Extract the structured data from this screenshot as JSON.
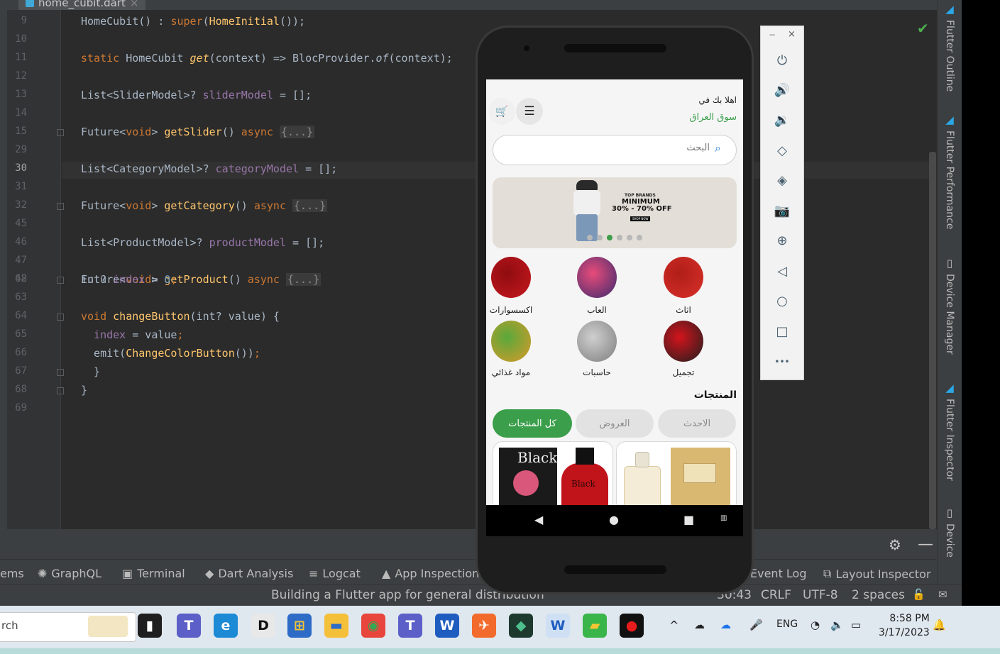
{
  "ide": {
    "tab_title": "home_cubit.dart",
    "tab_close": "×",
    "check_icon": "✔",
    "lines": [
      {
        "n": "9",
        "code": [
          [
            "",
            "HomeCubit() : "
          ],
          [
            "kw",
            "super"
          ],
          [
            "",
            "("
          ],
          [
            "fn",
            "HomeInitial"
          ],
          [
            "",
            "());"
          ]
        ]
      },
      {
        "n": "10",
        "code": []
      },
      {
        "n": "11",
        "code": [
          [
            "kw",
            "static "
          ],
          [
            "",
            "HomeCubit "
          ],
          [
            "fn italic",
            "get"
          ],
          [
            "",
            "(context) => BlocProvider."
          ],
          [
            "italic",
            "of"
          ],
          [
            "",
            "(context);"
          ]
        ]
      },
      {
        "n": "12",
        "code": []
      },
      {
        "n": "13",
        "code": [
          [
            "",
            "List<SliderModel>? "
          ],
          [
            "fld",
            "sliderModel"
          ],
          [
            "",
            " = [];"
          ]
        ]
      },
      {
        "n": "14",
        "code": []
      },
      {
        "n": "15",
        "code": [
          [
            "",
            "Future<"
          ],
          [
            "kw",
            "void"
          ],
          [
            "",
            "> "
          ],
          [
            "fn",
            "getSlider"
          ],
          [
            "",
            "() "
          ],
          [
            "kw",
            "async "
          ],
          [
            "fold-box",
            "{...}"
          ]
        ]
      },
      {
        "n": "29",
        "code": []
      },
      {
        "n": "30",
        "code": [
          [
            "",
            "List<CategoryModel>? "
          ],
          [
            "fld",
            "categoryModel"
          ],
          [
            "",
            " = [];"
          ]
        ]
      },
      {
        "n": "31",
        "code": []
      },
      {
        "n": "32",
        "code": [
          [
            "",
            "Future<"
          ],
          [
            "kw",
            "void"
          ],
          [
            "",
            "> "
          ],
          [
            "fn",
            "getCategory"
          ],
          [
            "",
            "() "
          ],
          [
            "kw",
            "async "
          ],
          [
            "fold-box",
            "{...}"
          ]
        ]
      },
      {
        "n": "45",
        "code": []
      },
      {
        "n": "46",
        "code": [
          [
            "",
            "List<ProductModel>? "
          ],
          [
            "fld",
            "productModel"
          ],
          [
            "",
            " = [];"
          ]
        ]
      },
      {
        "n": "47",
        "code": []
      },
      {
        "n": "48",
        "code": [
          [
            "",
            "Future<"
          ],
          [
            "kw",
            "void"
          ],
          [
            "",
            "> "
          ],
          [
            "fn",
            "getProduct"
          ],
          [
            "",
            "() "
          ],
          [
            "kw",
            "async "
          ],
          [
            "fold-box",
            "{...}"
          ]
        ]
      },
      {
        "n": "62",
        "code": [
          [
            "",
            "int? "
          ],
          [
            "fld",
            "index"
          ],
          [
            "",
            " = "
          ],
          [
            "num",
            "0"
          ],
          [
            "kw",
            ";"
          ]
        ]
      },
      {
        "n": "63",
        "code": []
      },
      {
        "n": "64",
        "code": [
          [
            "kw",
            "void "
          ],
          [
            "fn",
            "changeButton"
          ],
          [
            "",
            "(int? value) {"
          ]
        ]
      },
      {
        "n": "65",
        "code": [
          [
            "",
            "  "
          ],
          [
            "fld",
            "index"
          ],
          [
            "",
            " = value"
          ],
          [
            "kw",
            ";"
          ]
        ]
      },
      {
        "n": "66",
        "code": [
          [
            "",
            "  emit("
          ],
          [
            "fn",
            "ChangeColorButton"
          ],
          [
            "",
            "())"
          ],
          [
            "kw",
            ";"
          ]
        ]
      },
      {
        "n": "67",
        "code": [
          [
            "",
            "  }"
          ]
        ]
      },
      {
        "n": "68",
        "code": [
          [
            "",
            "}"
          ]
        ]
      },
      {
        "n": "69",
        "code": []
      }
    ],
    "current_line": "30",
    "right_tabs": [
      "Flutter Outline",
      "Flutter Performance",
      "Device Manager",
      "Flutter Inspector",
      "Device"
    ],
    "tool_windows": [
      {
        "label": "ems",
        "icon": ""
      },
      {
        "label": "GraphQL",
        "icon": "✺"
      },
      {
        "label": "Terminal",
        "icon": "▣"
      },
      {
        "label": "Dart Analysis",
        "icon": "◆"
      },
      {
        "label": "Logcat",
        "icon": "≡"
      },
      {
        "label": "App Inspection",
        "icon": "▲"
      },
      {
        "label": "Event Log",
        "icon": ""
      },
      {
        "label": "Layout Inspector",
        "icon": "⧉"
      }
    ],
    "status_message": "Building a Flutter app for general distribution",
    "status_position": "30:43",
    "status_line_ending": "CRLF",
    "status_encoding": "UTF-8",
    "status_indent": "2 spaces",
    "status_lock_icon": "🔓",
    "status_notify_icon": "✉"
  },
  "emulator": {
    "window_minimize": "−",
    "window_close": "×",
    "controls": [
      "power-icon",
      "volume-up-icon",
      "volume-down-icon",
      "rotate-left-icon",
      "rotate-right-icon",
      "camera-icon",
      "zoom-icon",
      "back-icon",
      "home-icon",
      "overview-icon",
      "more-icon"
    ],
    "control_glyphs": [
      "⏻",
      "🔊",
      "🔉",
      "◇",
      "◈",
      "📷",
      "⊕",
      "◁",
      "○",
      "□",
      "•••"
    ]
  },
  "app": {
    "greeting_line1": "اهلا بك في",
    "greeting_line2": "سوق العراق",
    "menu_icon": "☰",
    "cart_icon": "🛒",
    "search_placeholder": "البحث",
    "search_icon": "⌕",
    "banner": {
      "top": "TOP BRANDS",
      "headline": "MINIMUM",
      "offer": "30% - 70% OFF",
      "cta": "SHOP NOW"
    },
    "carousel_dots": 6,
    "carousel_active": 2,
    "categories": [
      {
        "label": "اثاث",
        "color": "#d9302a",
        "accent": "#b01e18"
      },
      {
        "label": "العاب",
        "color": "#3b2a6e",
        "accent": "#e84c7a"
      },
      {
        "label": "اكسسوارات",
        "color": "#c7191f",
        "accent": "#8e0c10"
      },
      {
        "label": "تجميل",
        "color": "#1e1e1e",
        "accent": "#d3141c"
      },
      {
        "label": "حاسبات",
        "color": "#7e7e7e",
        "accent": "#cfcfcf"
      },
      {
        "label": "مواد غذائي",
        "color": "#d99a2a",
        "accent": "#59a83a"
      }
    ],
    "products_title": "المنتجات",
    "filters": [
      {
        "label": "الاحدث",
        "active": false
      },
      {
        "label": "العروض",
        "active": false
      },
      {
        "label": "كل المنتجات",
        "active": true
      }
    ],
    "product1_brand": "Black",
    "product1_bottle": "Black",
    "accent_green": "#3a9e4a"
  },
  "taskbar": {
    "search_text": "rch",
    "apps": [
      {
        "name": "task-view-icon",
        "glyph": "▮",
        "bg": "#1f1f1f",
        "fg": "#fff"
      },
      {
        "name": "teams-icon",
        "glyph": "T",
        "bg": "#5b5fc7",
        "fg": "#fff"
      },
      {
        "name": "edge-icon",
        "glyph": "e",
        "bg": "#1c8ad4",
        "fg": "#fff"
      },
      {
        "name": "dell-icon",
        "glyph": "D",
        "bg": "#e8e8e8",
        "fg": "#111"
      },
      {
        "name": "store-icon",
        "glyph": "⊞",
        "bg": "#2d6bc7",
        "fg": "#f7c531"
      },
      {
        "name": "explorer-icon",
        "glyph": "▬",
        "bg": "#f5c039",
        "fg": "#2d6bc7"
      },
      {
        "name": "chrome-icon",
        "glyph": "◉",
        "bg": "#e8453c",
        "fg": "#34a853"
      },
      {
        "name": "teams2-icon",
        "glyph": "T",
        "bg": "#5b5fc7",
        "fg": "#fff"
      },
      {
        "name": "word-icon",
        "glyph": "W",
        "bg": "#1f5cbf",
        "fg": "#fff"
      },
      {
        "name": "postman-icon",
        "glyph": "✈",
        "bg": "#f36b2c",
        "fg": "#fff"
      },
      {
        "name": "android-studio-icon",
        "glyph": "◆",
        "bg": "#1e3a2f",
        "fg": "#4fc08d"
      },
      {
        "name": "word2-icon",
        "glyph": "W",
        "bg": "#cfe0f5",
        "fg": "#1f5cbf"
      },
      {
        "name": "bluestacks-icon",
        "glyph": "▰",
        "bg": "#39b54a",
        "fg": "#f7c531"
      },
      {
        "name": "record-icon",
        "glyph": "●",
        "bg": "#111",
        "fg": "#e81c1c"
      }
    ],
    "tray_chevron": "^",
    "tray_lang": "ENG",
    "time": "8:58 PM",
    "date": "3/17/2023"
  }
}
